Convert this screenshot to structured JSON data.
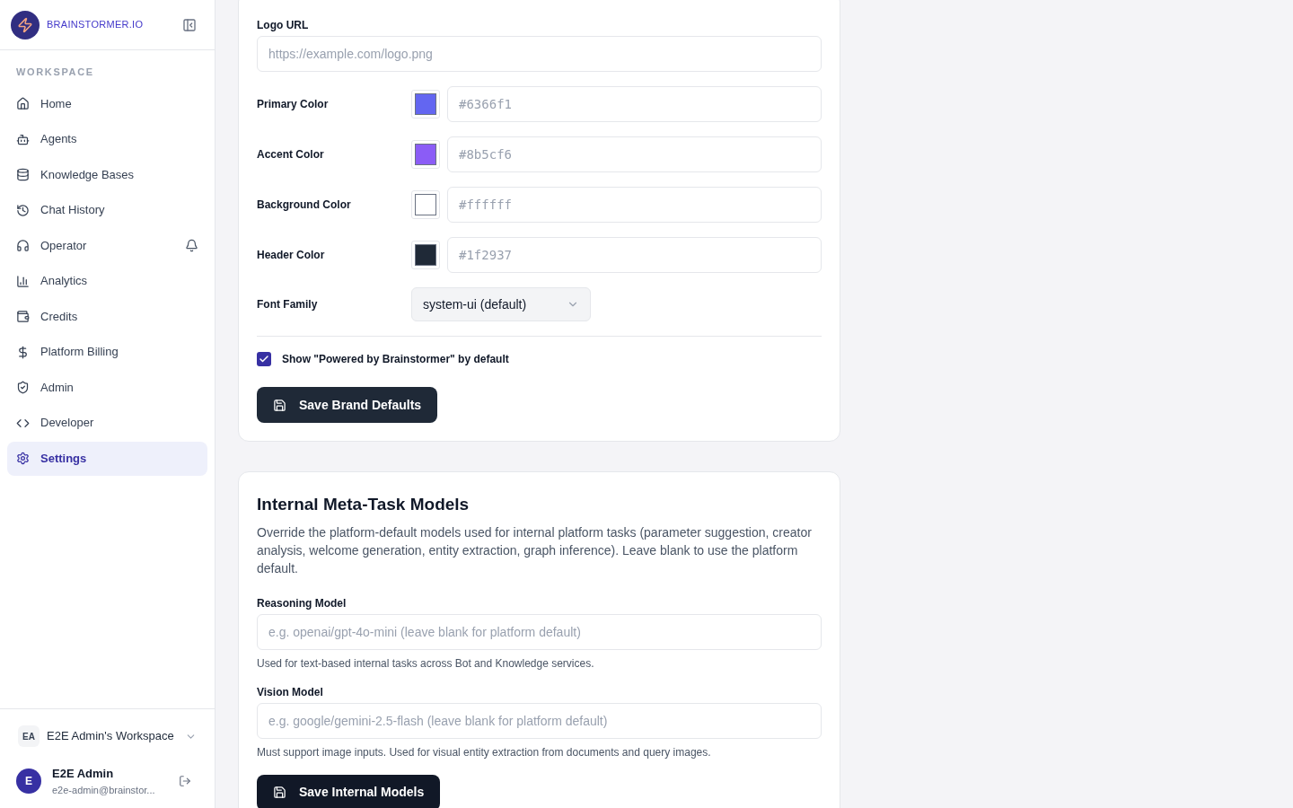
{
  "sidebar": {
    "logo_text": "BRAINSTORMER.IO",
    "section_label": "WORKSPACE",
    "items": [
      {
        "label": "Home",
        "selected": false
      },
      {
        "label": "Agents",
        "selected": false
      },
      {
        "label": "Knowledge Bases",
        "selected": false
      },
      {
        "label": "Chat History",
        "selected": false
      },
      {
        "label": "Operator",
        "selected": false,
        "bell": true
      },
      {
        "label": "Analytics",
        "selected": false
      },
      {
        "label": "Credits",
        "selected": false
      },
      {
        "label": "Platform Billing",
        "selected": false
      },
      {
        "label": "Admin",
        "selected": false
      },
      {
        "label": "Developer",
        "selected": false
      },
      {
        "label": "Settings",
        "selected": true
      }
    ],
    "workspace": {
      "initials": "EA",
      "name": "E2E Admin's Workspace"
    },
    "user": {
      "initial": "E",
      "name": "E2E Admin",
      "email": "e2e-admin@brainstor..."
    }
  },
  "brand_card": {
    "fields": [
      {
        "kind": "text",
        "label": "Logo URL",
        "placeholder": "https://example.com/logo.png"
      },
      {
        "kind": "color",
        "label": "Primary Color",
        "placeholder": "#6366f1",
        "color": "#6366f1"
      },
      {
        "kind": "color",
        "label": "Accent Color",
        "placeholder": "#8b5cf6",
        "color": "#8b5cf6"
      },
      {
        "kind": "color",
        "label": "Background Color",
        "placeholder": "#ffffff",
        "color": "#ffffff"
      },
      {
        "kind": "color",
        "label": "Header Color",
        "placeholder": "#1f2937",
        "color": "#1f2937"
      },
      {
        "kind": "select",
        "label": "Font Family",
        "value": "system-ui (default)"
      }
    ],
    "checkbox": {
      "label": "Show \"Powered by Brainstormer\" by default",
      "checked": true
    },
    "button": "Save Brand Defaults"
  },
  "models_card": {
    "title": "Internal Meta-Task Models",
    "description": "Override the platform-default models used for internal platform tasks (parameter suggestion, creator analysis, welcome generation, entity extraction, graph inference). Leave blank to use the platform default.",
    "fields": [
      {
        "label": "Reasoning Model",
        "placeholder": "e.g. openai/gpt-4o-mini (leave blank for platform default)",
        "help": "Used for text-based internal tasks across Bot and Knowledge services."
      },
      {
        "label": "Vision Model",
        "placeholder": "e.g. google/gemini-2.5-flash (leave blank for platform default)",
        "help": "Must support image inputs. Used for visual entity extraction from documents and query images."
      }
    ],
    "button": "Save Internal Models"
  }
}
